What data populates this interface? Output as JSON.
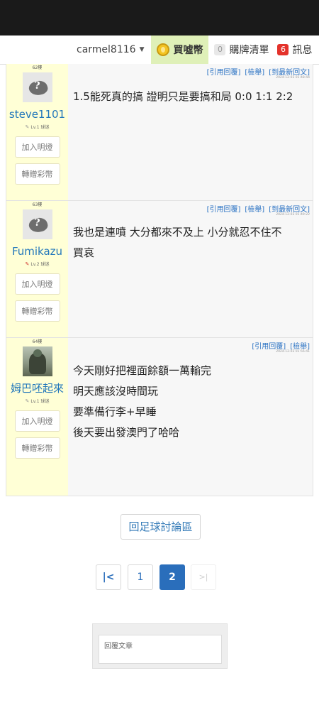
{
  "navbar": {
    "username": "carmel8116",
    "coin_label": "買噓幣",
    "cart_count": "0",
    "cart_label": "購牌清單",
    "msg_count": "6",
    "msg_label": "訊息"
  },
  "posts": [
    {
      "floor": "62樓",
      "username": "steve1101",
      "level": "Lv.1 球迷",
      "follow_label": "加入明燈",
      "gift_label": "轉贈彩幣",
      "actions": [
        "[引用回覆]",
        "[檢舉]",
        "[到最新回文]"
      ],
      "timestamp": "2024-12-03 01:48:44",
      "lines": [
        "1.5能死真的搞 證明只是要搞和局 0:0 1:1 2:2"
      ]
    },
    {
      "floor": "63樓",
      "username": "Fumikazu",
      "level": "Lv.2 球迷",
      "follow_label": "加入明燈",
      "gift_label": "轉贈彩幣",
      "actions": [
        "[引用回覆]",
        "[檢舉]",
        "[到最新回文]"
      ],
      "timestamp": "2024-12-03 01:49:22",
      "lines": [
        "我也是連噴 大分都來不及上 小分就忍不住不",
        "買哀"
      ]
    },
    {
      "floor": "64樓",
      "username": "姆巴呸起來",
      "level": "Lv.1 球迷",
      "follow_label": "加入明燈",
      "gift_label": "轉贈彩幣",
      "actions": [
        "[引用回覆]",
        "[檢舉]"
      ],
      "timestamp": "2024-12-03 01:56:41",
      "lines": [
        "今天剛好把裡面餘額一萬輸完",
        "明天應該沒時間玩",
        "要準備行李+早睡",
        "後天要出發澳門了哈哈"
      ]
    }
  ],
  "back_button": "回足球討論區",
  "pagination": {
    "first": "|<",
    "pages": [
      "1",
      "2"
    ],
    "current": "2",
    "last": ">|"
  },
  "reply": {
    "placeholder": "回覆文章"
  },
  "colors": {
    "accent": "#2a6ebb",
    "author_bg": "#ffffd6",
    "coin_bg": "#dff0b8",
    "badge_red": "#e4322b"
  }
}
